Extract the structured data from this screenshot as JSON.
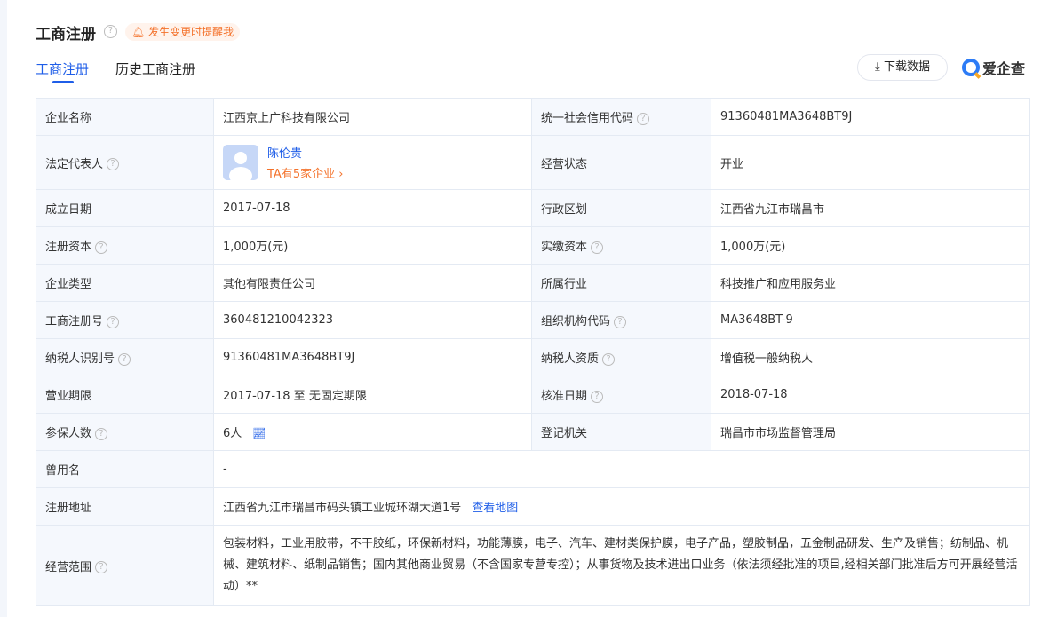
{
  "header": {
    "title": "工商注册",
    "remind": "发生变更时提醒我",
    "download": "下载数据",
    "logo": "爱企查"
  },
  "tabs": [
    {
      "label": "工商注册"
    },
    {
      "label": "历史工商注册"
    }
  ],
  "rows": [
    [
      {
        "l": "企业名称",
        "v": "江西京上广科技有限公司"
      },
      {
        "l": "统一社会信用代码",
        "h": true,
        "v": "91360481MA3648BT9J"
      }
    ],
    [
      {
        "l": "法定代表人",
        "h": true,
        "person": true
      },
      {
        "l": "经营状态",
        "v": "开业"
      }
    ],
    [
      {
        "l": "成立日期",
        "v": "2017-07-18"
      },
      {
        "l": "行政区划",
        "v": "江西省九江市瑞昌市"
      }
    ],
    [
      {
        "l": "注册资本",
        "h": true,
        "v": "1,000万(元)"
      },
      {
        "l": "实缴资本",
        "h": true,
        "v": "1,000万(元)"
      }
    ],
    [
      {
        "l": "企业类型",
        "v": "其他有限责任公司"
      },
      {
        "l": "所属行业",
        "v": "科技推广和应用服务业"
      }
    ],
    [
      {
        "l": "工商注册号",
        "h": true,
        "v": "360481210042323"
      },
      {
        "l": "组织机构代码",
        "h": true,
        "v": "MA3648BT-9"
      }
    ],
    [
      {
        "l": "纳税人识别号",
        "h": true,
        "v": "91360481MA3648BT9J"
      },
      {
        "l": "纳税人资质",
        "h": true,
        "v": "增值税一般纳税人"
      }
    ],
    [
      {
        "l": "营业期限",
        "v": "2017-07-18 至 无固定期限"
      },
      {
        "l": "核准日期",
        "h": true,
        "v": "2018-07-18"
      }
    ],
    [
      {
        "l": "参保人数",
        "h": true,
        "v": "6人",
        "chart": true
      },
      {
        "l": "登记机关",
        "v": "瑞昌市市场监督管理局"
      }
    ]
  ],
  "legal_rep": {
    "name": "陈伦贵",
    "companies": "TA有5家企业"
  },
  "former_name": {
    "label": "曾用名",
    "value": "-"
  },
  "address": {
    "label": "注册地址",
    "value": "江西省九江市瑞昌市码头镇工业城环湖大道1号",
    "map_link": "查看地图"
  },
  "scope": {
    "label": "经营范围",
    "value": "包装材料，工业用胶带，不干胶纸，环保新材料，功能薄膜，电子、汽车、建材类保护膜，电子产品，塑胶制品，五金制品研发、生产及销售；纺制品、机械、建筑材料、纸制品销售；国内其他商业贸易（不含国家专营专控）；从事货物及技术进出口业务（依法须经批准的项目,经相关部门批准后方可开展经营活动）**"
  }
}
